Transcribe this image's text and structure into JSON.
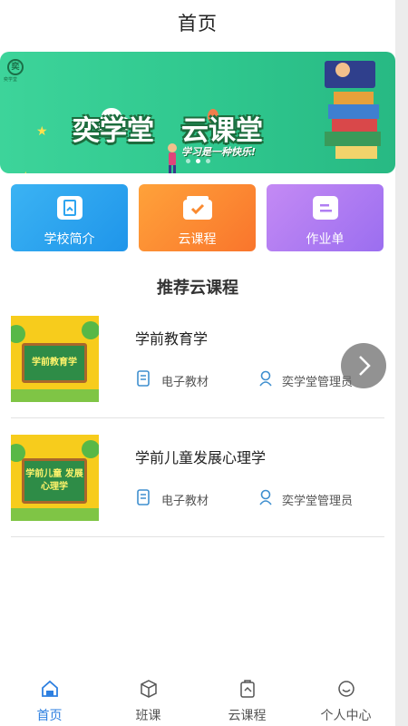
{
  "header": {
    "title": "首页"
  },
  "banner": {
    "logo_char": "奕",
    "logo_sub": "奕学堂",
    "headline_left": "奕学堂",
    "headline_right": "云课堂",
    "slogan": "学习是一种快乐!",
    "dots": 3,
    "active_dot": 1
  },
  "nav": [
    {
      "label": "学校简介",
      "icon": "book-icon",
      "color": "#2ea5f0"
    },
    {
      "label": "云课程",
      "icon": "checkbox-box-icon",
      "color": "#fa8a30"
    },
    {
      "label": "作业单",
      "icon": "document-lines-icon",
      "color": "#b07ef3"
    }
  ],
  "section": {
    "title": "推荐云课程"
  },
  "courses": [
    {
      "title": "学前教育学",
      "thumb_text": "学前教育学",
      "material": "电子教材",
      "author": "奕学堂管理员"
    },
    {
      "title": "学前儿童发展心理学",
      "thumb_text": "学前儿童 发展心理学",
      "material": "电子教材",
      "author": "奕学堂管理员"
    }
  ],
  "tabs": [
    {
      "label": "首页",
      "icon": "home-icon",
      "active": true
    },
    {
      "label": "班课",
      "icon": "cube-icon",
      "active": false
    },
    {
      "label": "云课程",
      "icon": "clipboard-icon",
      "active": false
    },
    {
      "label": "个人中心",
      "icon": "smiley-icon",
      "active": false
    }
  ],
  "colors": {
    "accent": "#2d7fe0",
    "banner_green": "#34cc94",
    "meta_blue": "#3f8fcf"
  }
}
